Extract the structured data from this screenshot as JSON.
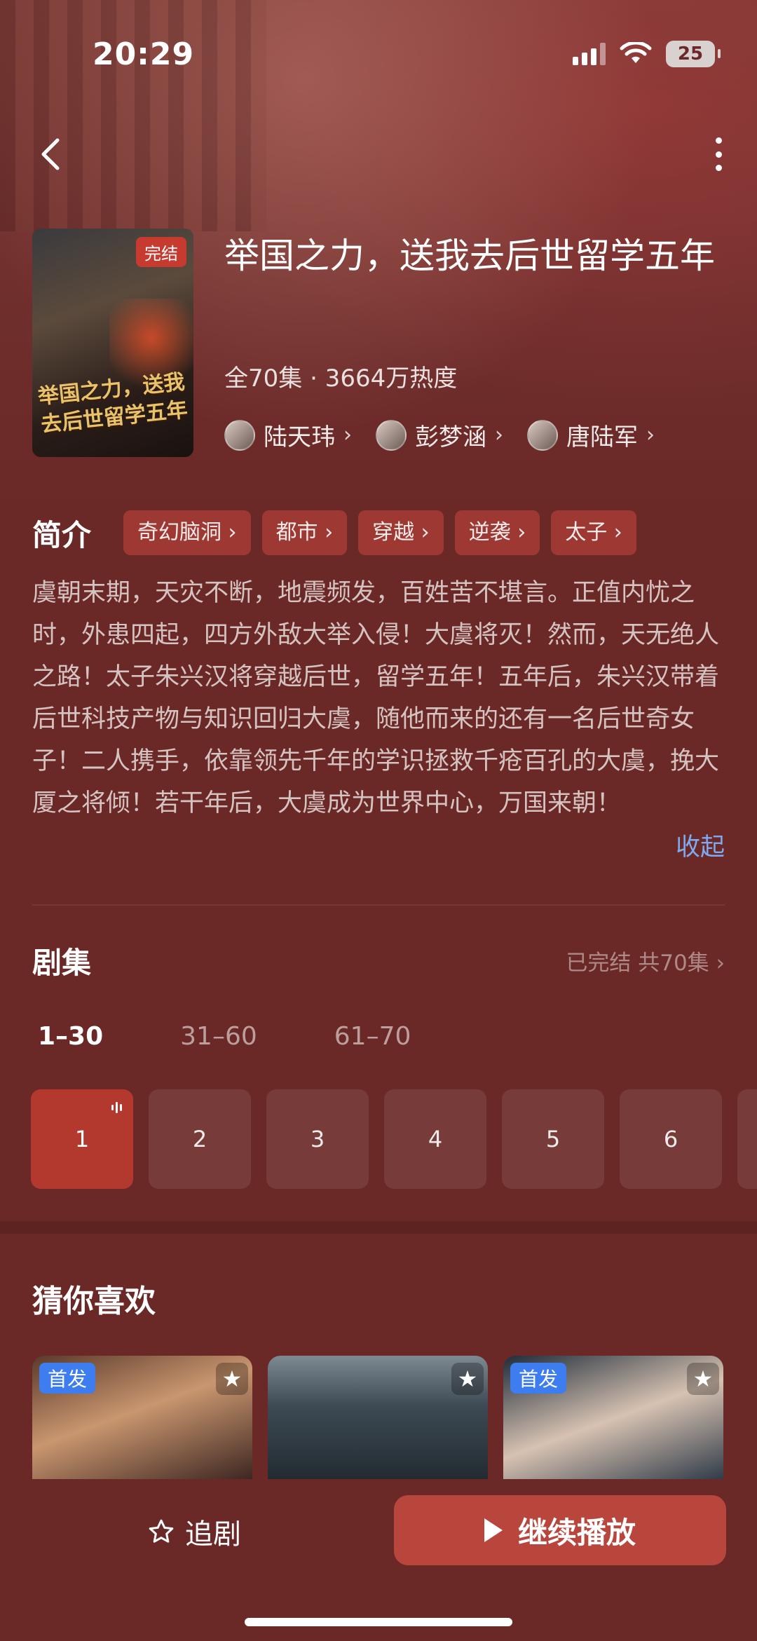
{
  "status_bar": {
    "time": "20:29",
    "battery": "25"
  },
  "drama": {
    "badge": "完结",
    "poster_title": "举国之力，送我去后世留学五年",
    "title": "举国之力，送我去后世留学五年",
    "meta": "全70集 · 3664万热度",
    "cast": [
      {
        "name": "陆天玮"
      },
      {
        "name": "彭梦涵"
      },
      {
        "name": "唐陆军"
      }
    ]
  },
  "synopsis": {
    "title": "简介",
    "tags": [
      "奇幻脑洞",
      "都市",
      "穿越",
      "逆袭",
      "太子"
    ],
    "text": "虞朝末期，天灾不断，地震频发，百姓苦不堪言。正值内忧之时，外患四起，四方外敌大举入侵！大虞将灭！然而，天无绝人之路！太子朱兴汉将穿越后世，留学五年！五年后，朱兴汉带着后世科技产物与知识回归大虞，随他而来的还有一名后世奇女子！二人携手，依靠领先千年的学识拯救千疮百孔的大虞，挽大厦之将倾！若干年后，大虞成为世界中心，万国来朝！",
    "collapse_label": "收起"
  },
  "episodes": {
    "title": "剧集",
    "status": "已完结 共70集",
    "ranges": [
      "1–30",
      "31–60",
      "61–70"
    ],
    "active_range": 0,
    "items": [
      "1",
      "2",
      "3",
      "4",
      "5",
      "6"
    ],
    "current": "1"
  },
  "recommend": {
    "title": "猜你喜欢",
    "cards": [
      {
        "badge": "首发"
      },
      {
        "badge": ""
      },
      {
        "badge": "首发"
      }
    ]
  },
  "actions": {
    "follow_label": "追剧",
    "play_label": "继续播放"
  },
  "colors": {
    "background": "#6a2826",
    "accent": "#b9463c",
    "active_episode": "#b3392f",
    "link": "#7fa9f0",
    "badge_blue": "#3d7df0"
  }
}
